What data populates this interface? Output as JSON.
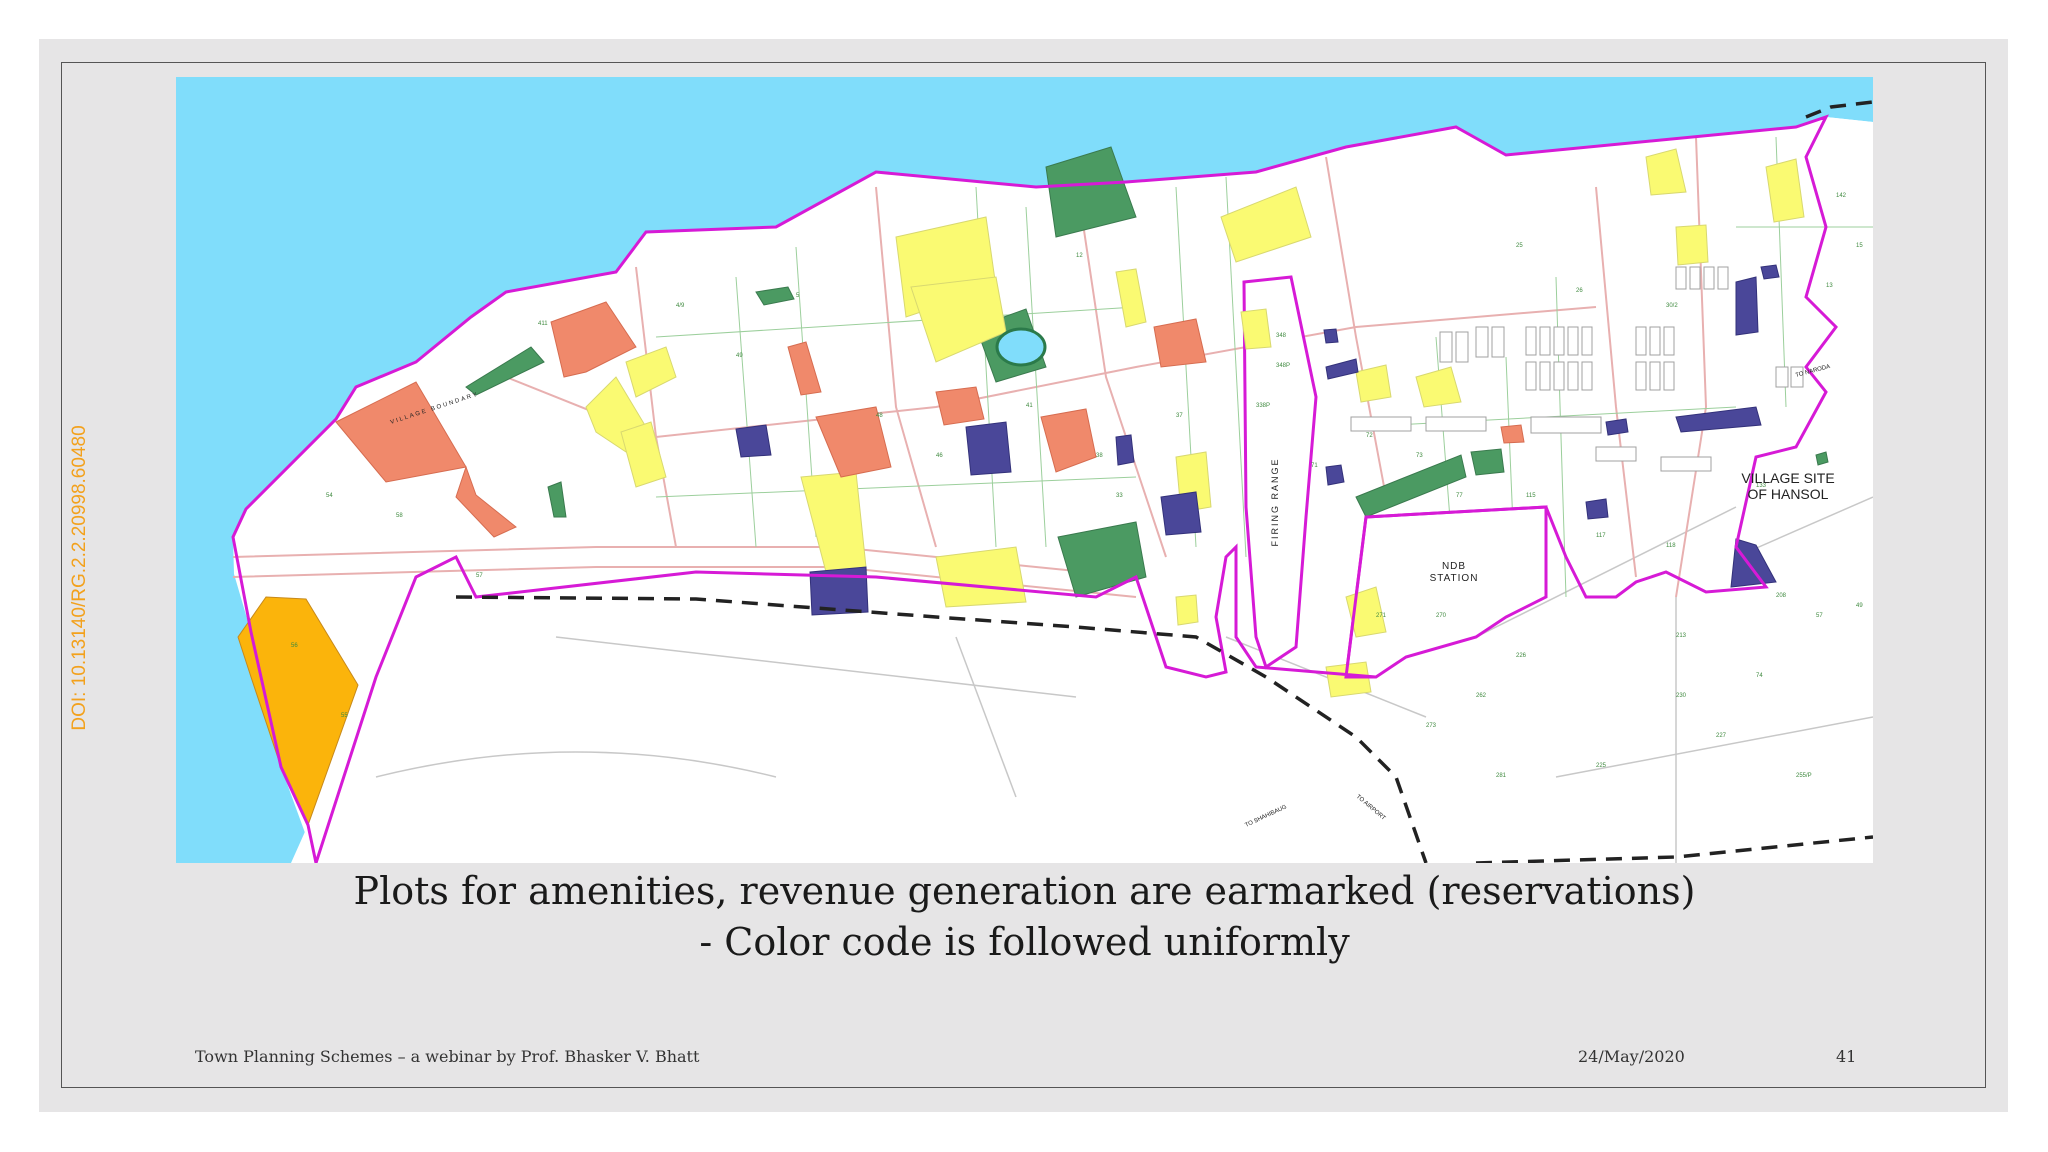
{
  "slide": {
    "doi": "DOI: 10.13140/RG.2.2.20998.60480",
    "caption_line1": "Plots for amenities, revenue generation are earmarked (reservations)",
    "caption_line2": "- Color code is followed uniformly",
    "footer_left": "Town Planning Schemes – a webinar by Prof. Bhasker V. Bhatt",
    "footer_date": "24/May/2020",
    "page_number": "41"
  },
  "map": {
    "labels": {
      "village_site_line1": "VILLAGE SITE",
      "village_site_line2": "OF HANSOL",
      "ndb_line1": "NDB",
      "ndb_line2": "STATION",
      "firing_range": "FIRING RANGE",
      "to_naroda": "TO NARODA",
      "to_shahibaug": "TO SHAHIBAUG",
      "to_airport": "TO AIRPORT",
      "village_boundary": "VILLAGE BOUNDARY"
    },
    "colors": {
      "water": "#80ddfb",
      "scheme_boundary": "#d61ad6",
      "garden": "#4b9a62",
      "public_amenity": "#fafa72",
      "sale_plot": "#f0896b",
      "social_infrastructure": "#4a4799",
      "open_space": "#fbb40b",
      "doi_text": "#f3a11c"
    }
  }
}
